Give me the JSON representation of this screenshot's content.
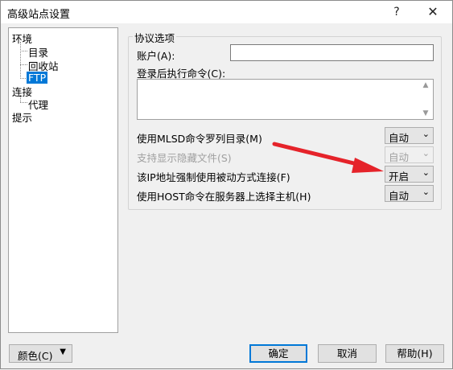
{
  "window": {
    "title": "高级站点设置",
    "help_glyph": "?",
    "close_glyph": "✕"
  },
  "tree": {
    "env": "环境",
    "dir": "目录",
    "recycle": "回收站",
    "ftp": "FTP",
    "connect": "连接",
    "proxy": "代理",
    "hint": "提示"
  },
  "protocol": {
    "group_title": "协议选项",
    "account_label": "账户(A):",
    "account_value": "",
    "post_login_label": "登录后执行命令(C):",
    "post_login_value": "",
    "rows": [
      {
        "label": "使用MLSD命令罗列目录(M)",
        "value": "自动",
        "enabled": "true"
      },
      {
        "label": "支持显示隐藏文件(S)",
        "value": "自动",
        "enabled": "false"
      },
      {
        "label": "该IP地址强制使用被动方式连接(F)",
        "value": "开启",
        "enabled": "true"
      },
      {
        "label": "使用HOST命令在服务器上选择主机(H)",
        "value": "自动",
        "enabled": "true"
      }
    ]
  },
  "footer": {
    "color_button": "颜色(C)",
    "ok": "确定",
    "cancel": "取消",
    "help": "帮助(H)"
  },
  "colors": {
    "accent": "#0078d7",
    "arrow": "#e5232a"
  }
}
